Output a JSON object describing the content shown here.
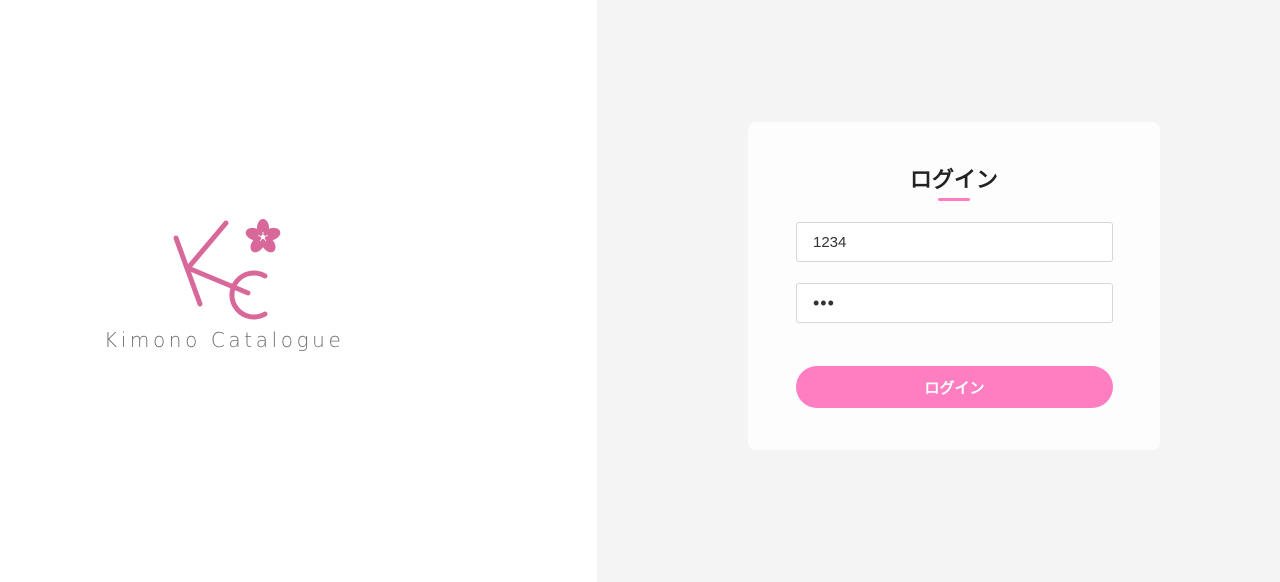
{
  "brand": {
    "logo_icon": "kc-logo-with-sakura-icon",
    "name": "Kimono Catalogue",
    "accent_color": "#d9689a"
  },
  "login": {
    "title": "ログイン",
    "user_id_value": "1234",
    "password_value": "123",
    "button_label": "ログイン",
    "button_color": "#ff7ec2"
  }
}
